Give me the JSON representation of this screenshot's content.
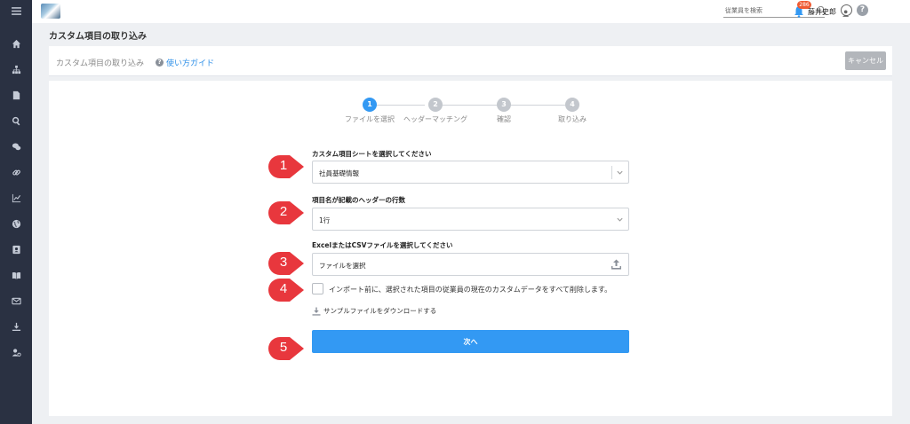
{
  "topbar": {
    "search_placeholder": "従業員を検索",
    "notification_count": "286",
    "user_name": "藤井史郎",
    "help_label": "?"
  },
  "sidebar": {
    "items": [
      "menu-icon",
      "home-icon",
      "org-chart-icon",
      "document-icon",
      "search-icon",
      "chat-icon",
      "link-icon",
      "chart-icon",
      "globe-icon",
      "contact-card-icon",
      "book-icon",
      "mail-icon",
      "download-icon",
      "user-settings-icon"
    ]
  },
  "page": {
    "title": "カスタム項目の取り込み"
  },
  "card_header": {
    "breadcrumb": "カスタム項目の取り込み",
    "guide_link": "使い方ガイド",
    "cancel_label": "キャンセル"
  },
  "steps": [
    {
      "number": "1",
      "label": "ファイルを選択",
      "active": true
    },
    {
      "number": "2",
      "label": "ヘッダーマッチング",
      "active": false
    },
    {
      "number": "3",
      "label": "確認",
      "active": false
    },
    {
      "number": "4",
      "label": "取り込み",
      "active": false
    }
  ],
  "colors": {
    "active_step": "#3399f3",
    "inactive_step": "#c3c7cd",
    "primary": "#3399f3",
    "callout": "#e8373d",
    "sidebar": "#2a3142"
  },
  "form": {
    "sheet_label": "カスタム項目シートを選択してください",
    "sheet_value": "社員基礎情報",
    "header_rows_label": "項目名が記載のヘッダーの行数",
    "header_rows_value": "1行",
    "file_label": "ExcelまたはCSVファイルを選択してください",
    "file_placeholder": "ファイルを選択",
    "delete_checkbox_label": "インポート前に、選択された項目の従業員の現在のカスタムデータをすべて削除します。",
    "sample_download": "サンプルファイルをダウンロードする",
    "next_label": "次へ"
  },
  "callouts": [
    "1",
    "2",
    "3",
    "4",
    "5"
  ]
}
